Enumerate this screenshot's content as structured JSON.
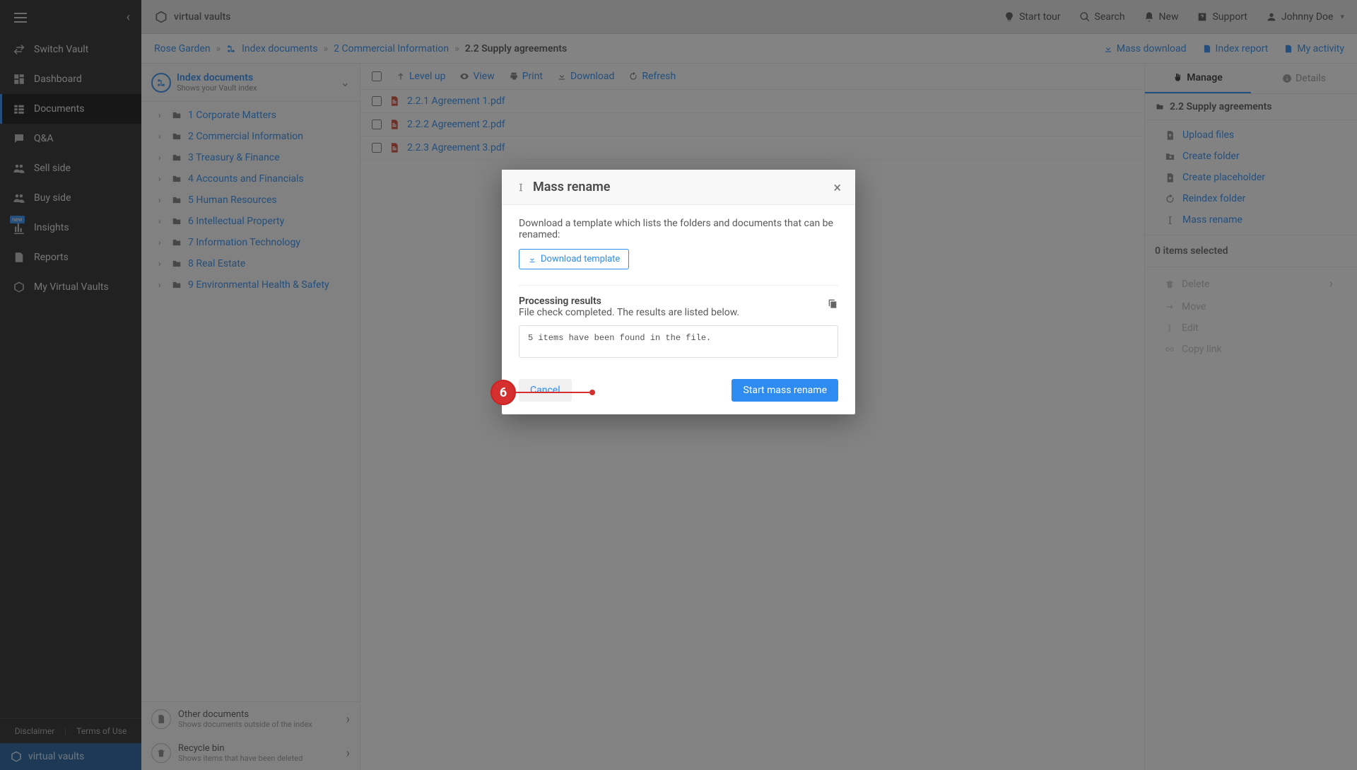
{
  "brand": "virtual vaults",
  "topbar": {
    "start_tour": "Start tour",
    "search": "Search",
    "new": "New",
    "support": "Support",
    "user": "Johnny Doe"
  },
  "sidebar": {
    "switch_vault": "Switch Vault",
    "dashboard": "Dashboard",
    "documents": "Documents",
    "qa": "Q&A",
    "sell_side": "Sell side",
    "buy_side": "Buy side",
    "insights": "Insights",
    "reports": "Reports",
    "my_vaults": "My Virtual Vaults",
    "disclaimer": "Disclaimer",
    "terms": "Terms of Use"
  },
  "crumbs": {
    "root": "Rose Garden",
    "l1": "Index documents",
    "l2": "2 Commercial Information",
    "current": "2.2 Supply agreements"
  },
  "quick": {
    "mass_download": "Mass download",
    "index_report": "Index report",
    "my_activity": "My activity"
  },
  "tree": {
    "head_title": "Index documents",
    "head_sub": "Shows your Vault index",
    "items": [
      "1 Corporate Matters",
      "2 Commercial Information",
      "3 Treasury & Finance",
      "4 Accounts and Financials",
      "5 Human Resources",
      "6 Intellectual Property",
      "7 Information Technology",
      "8 Real Estate",
      "9 Environmental Health & Safety"
    ],
    "other_docs_t": "Other documents",
    "other_docs_s": "Shows documents outside of the index",
    "recycle_t": "Recycle bin",
    "recycle_s": "Shows items that have been deleted"
  },
  "filetools": {
    "level_up": "Level up",
    "view": "View",
    "print": "Print",
    "download": "Download",
    "refresh": "Refresh"
  },
  "files": [
    "2.2.1 Agreement 1.pdf",
    "2.2.2 Agreement 2.pdf",
    "2.2.3 Agreement 3.pdf"
  ],
  "right": {
    "tab_manage": "Manage",
    "tab_details": "Details",
    "context": "2.2 Supply agreements",
    "actions": {
      "upload": "Upload files",
      "create_folder": "Create folder",
      "create_placeholder": "Create placeholder",
      "reindex": "Reindex folder",
      "mass_rename": "Mass rename"
    },
    "selected": "0 items selected",
    "disabled": {
      "delete": "Delete",
      "move": "Move",
      "edit": "Edit",
      "copy_link": "Copy link"
    }
  },
  "modal": {
    "title": "Mass rename",
    "intro": "Download a template which lists the folders and documents that can be renamed:",
    "dl_btn": "Download template",
    "proc_head": "Processing results",
    "proc_sub": "File check completed. The results are listed below.",
    "results": "5 items have been found in the file.",
    "cancel": "Cancel",
    "start": "Start mass rename"
  },
  "anno_step": "6"
}
